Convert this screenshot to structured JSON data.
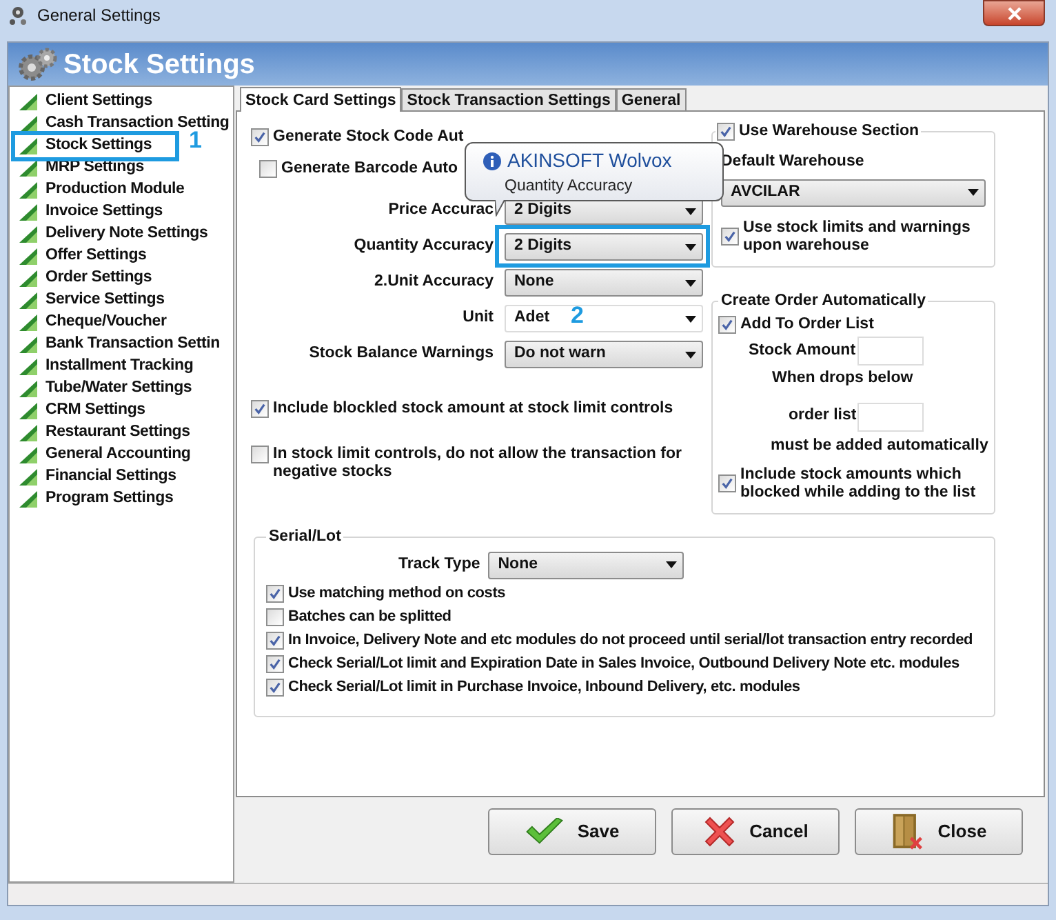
{
  "window": {
    "title": "General Settings"
  },
  "header": {
    "title": "Stock Settings"
  },
  "sidebar": {
    "items": [
      {
        "label": "Client Settings"
      },
      {
        "label": "Cash Transaction Setting"
      },
      {
        "label": "Stock Settings"
      },
      {
        "label": "MRP Settings"
      },
      {
        "label": "Production Module"
      },
      {
        "label": "Invoice Settings"
      },
      {
        "label": "Delivery Note Settings"
      },
      {
        "label": "Offer Settings"
      },
      {
        "label": "Order Settings"
      },
      {
        "label": "Service Settings"
      },
      {
        "label": "Cheque/Voucher"
      },
      {
        "label": "Bank Transaction Settin"
      },
      {
        "label": "Installment Tracking"
      },
      {
        "label": "Tube/Water Settings"
      },
      {
        "label": "CRM Settings"
      },
      {
        "label": "Restaurant Settings"
      },
      {
        "label": "General Accounting"
      },
      {
        "label": "Financial Settings"
      },
      {
        "label": "Program Settings"
      }
    ]
  },
  "tabs": [
    {
      "label": "Stock Card Settings",
      "selected": true
    },
    {
      "label": "Stock Transaction Settings",
      "selected": false
    },
    {
      "label": "General",
      "selected": false
    }
  ],
  "stock_card": {
    "options": [
      {
        "kind": "checkbox",
        "label": "Generate Stock Code Aut",
        "checked": true
      },
      {
        "kind": "checkbox",
        "label": "Generate Barcode Auto",
        "checked": false
      },
      {
        "kind": "select",
        "label": "Price Accurac",
        "value": "2 Digits",
        "editable": false
      },
      {
        "kind": "select",
        "label": "Quantity Accuracy",
        "value": "2 Digits",
        "editable": false
      },
      {
        "kind": "select",
        "label": "2.Unit Accuracy",
        "value": "None",
        "editable": false
      },
      {
        "kind": "select",
        "label": "Unit",
        "value": "Adet",
        "editable": true
      },
      {
        "kind": "select",
        "label": "Stock Balance Warnings",
        "value": "Do not warn",
        "editable": false
      },
      {
        "kind": "checkbox",
        "label": "Include blockled stock amount at stock limit controls",
        "checked": true
      },
      {
        "kind": "checkbox",
        "label": "In stock limit controls, do not allow the transaction for negative stocks",
        "checked": false
      }
    ]
  },
  "warehouse": {
    "label": "Use Warehouse Section",
    "checked": true,
    "default_label": "Default Warehouse",
    "default_value": "AVCILAR",
    "limits_label": "Use stock limits and warnings upon warehouse",
    "limits_checked": true
  },
  "create_order": {
    "title": "Create Order Automatically",
    "add_label": "Add To Order List",
    "add_checked": true,
    "stock_amount_label": "Stock Amount",
    "drops_text": "When drops below",
    "order_list_label": "order list",
    "added_text": "must be added automatically",
    "include_label": "Include stock amounts which blocked while adding to the list",
    "include_checked": true
  },
  "serial_lot": {
    "title": "Serial/Lot",
    "track_label": "Track Type",
    "track_value": "None",
    "options": [
      {
        "label": "Use matching method on costs",
        "checked": true
      },
      {
        "label": "Batches can be splitted",
        "checked": false
      },
      {
        "label": "In Invoice, Delivery Note and etc modules do not proceed until serial/lot transaction entry recorded",
        "checked": true
      },
      {
        "label": "Check Serial/Lot limit and Expiration Date in Sales Invoice, Outbound Delivery Note etc. modules",
        "checked": true
      },
      {
        "label": "Check Serial/Lot limit in Purchase Invoice, Inbound Delivery, etc. modules",
        "checked": true
      }
    ]
  },
  "buttons": [
    {
      "kind": "save",
      "label": "Save"
    },
    {
      "kind": "cancel",
      "label": "Cancel"
    },
    {
      "kind": "close",
      "label": "Close"
    }
  ],
  "tooltip": {
    "title": "AKINSOFT Wolvox",
    "text": "Quantity Accuracy"
  },
  "annotations": [
    {
      "kind": "sidebar",
      "label": "1"
    },
    {
      "kind": "field",
      "label": "2"
    }
  ]
}
